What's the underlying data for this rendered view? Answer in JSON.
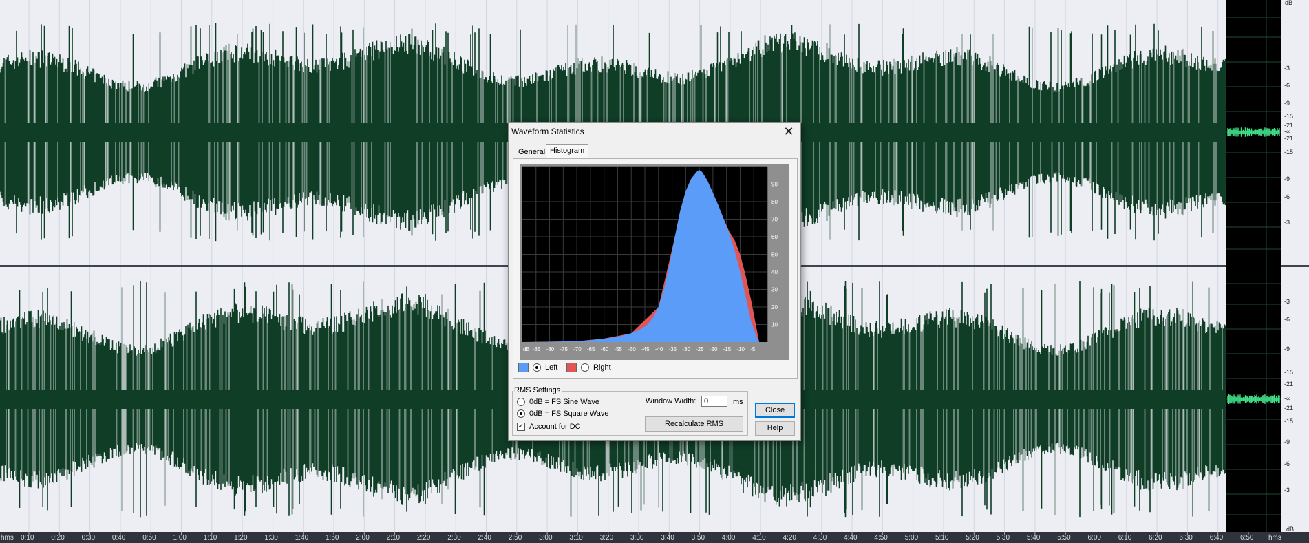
{
  "track": {
    "db_unit": "dB",
    "db_ticks_top": [
      "-3",
      "-6",
      "-9",
      "-15",
      "-21",
      "-∞",
      "-21",
      "-15",
      "-9",
      "-6",
      "-3"
    ],
    "db_ticks_bottom": [
      "-3",
      "-6",
      "-9",
      "-15",
      "-21",
      "-∞",
      "-21",
      "-15",
      "-9",
      "-6",
      "-3"
    ],
    "time_unit": "hms",
    "time_ticks": [
      "0:10",
      "0:20",
      "0:30",
      "0:40",
      "0:50",
      "1:00",
      "1:10",
      "1:20",
      "1:30",
      "1:40",
      "1:50",
      "2:00",
      "2:10",
      "2:20",
      "2:30",
      "2:40",
      "2:50",
      "3:00",
      "3:10",
      "3:20",
      "3:30",
      "3:40",
      "3:50",
      "4:00",
      "4:10",
      "4:20",
      "4:30",
      "4:40",
      "4:50",
      "5:00",
      "5:10",
      "5:20",
      "5:30",
      "5:40",
      "5:50",
      "6:00",
      "6:10",
      "6:20",
      "6:30",
      "6:40",
      "6:50"
    ],
    "time_unit_right": "hms",
    "colors": {
      "waveform": "#0f3d26",
      "background": "#eceef4",
      "meter_bg": "#000000",
      "meter_signal": "#3fe08a"
    }
  },
  "dialog": {
    "title": "Waveform Statistics",
    "close_glyph": "✕",
    "tabs": [
      {
        "label": "General",
        "selected": false
      },
      {
        "label": "Histogram",
        "selected": true
      }
    ],
    "legend": {
      "left_label": "Left",
      "right_label": "Right",
      "left_color": "#5b9cf8",
      "right_color": "#e05555",
      "selected": "Left"
    },
    "rms": {
      "group_label": "RMS Settings",
      "options": [
        {
          "label": "0dB = FS Sine Wave",
          "selected": false
        },
        {
          "label": "0dB = FS Square Wave",
          "selected": true
        }
      ],
      "account_dc_label": "Account for DC",
      "account_dc_checked": true,
      "window_width_label": "Window Width:",
      "window_width_value": "0",
      "window_width_unit": "ms",
      "recalc_label": "Recalculate RMS"
    },
    "close_label": "Close",
    "help_label": "Help"
  },
  "chart_data": {
    "type": "area",
    "x_ticks": [
      "dB",
      "-85",
      "-80",
      "-75",
      "-70",
      "-65",
      "-60",
      "-55",
      "-50",
      "-45",
      "-40",
      "-35",
      "-30",
      "-25",
      "-20",
      "-15",
      "-10",
      "-5"
    ],
    "y_ticks": [
      "90",
      "80",
      "70",
      "60",
      "50",
      "40",
      "30",
      "20",
      "10"
    ],
    "ylim": [
      0,
      100
    ],
    "xlim": [
      -90,
      0
    ],
    "grid": true,
    "series": [
      {
        "name": "Left",
        "color": "#5b9cf8",
        "x": [
          -90,
          -80,
          -70,
          -65,
          -60,
          -55,
          -50,
          -47,
          -44,
          -42,
          -40,
          -38,
          -36,
          -34,
          -32,
          -30,
          -28,
          -26,
          -25,
          -24,
          -22,
          -20,
          -18,
          -16,
          -14,
          -12,
          -10,
          -8,
          -6,
          -4,
          -3
        ],
        "y": [
          0,
          0.2,
          0.5,
          1,
          2,
          3,
          5,
          7,
          10,
          14,
          20,
          30,
          44,
          60,
          75,
          86,
          93,
          97,
          98,
          97,
          92,
          85,
          78,
          70,
          62,
          52,
          40,
          26,
          12,
          3,
          0
        ]
      },
      {
        "name": "Right",
        "color": "#e05555",
        "x": [
          -90,
          -70,
          -60,
          -50,
          -40,
          -30,
          -25,
          -20,
          -16,
          -14,
          -12,
          -10,
          -8,
          -6,
          -4,
          -3
        ],
        "y": [
          0,
          0.5,
          2,
          5,
          20,
          86,
          98,
          85,
          70,
          63,
          58,
          50,
          38,
          24,
          8,
          0
        ]
      }
    ]
  }
}
